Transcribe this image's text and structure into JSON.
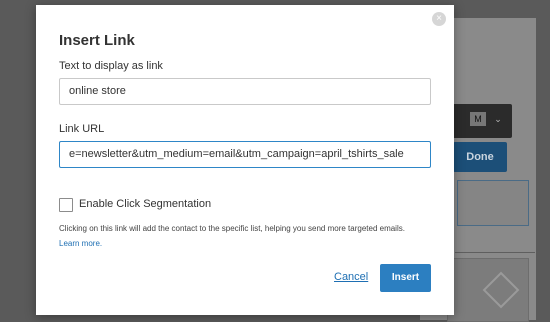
{
  "background": {
    "toolbar_m_label": "M",
    "toolbar_chevron": "⌄",
    "done_label": "Done"
  },
  "modal": {
    "title": "Insert Link",
    "close_icon": "×",
    "text_label": "Text to display as link",
    "text_value": "online store",
    "url_label": "Link URL",
    "url_value": "e=newsletter&utm_medium=email&utm_campaign=april_tshirts_sale",
    "checkbox_label": "Enable Click Segmentation",
    "checkbox_checked": false,
    "help_text": "Clicking on this link will add the contact to the specific list, helping you send more targeted emails.",
    "learn_more": "Learn more.",
    "cancel_label": "Cancel",
    "insert_label": "Insert"
  },
  "colors": {
    "accent": "#2c7fc1",
    "link": "#1e6fb3",
    "backdrop": "#5a5a5a"
  }
}
